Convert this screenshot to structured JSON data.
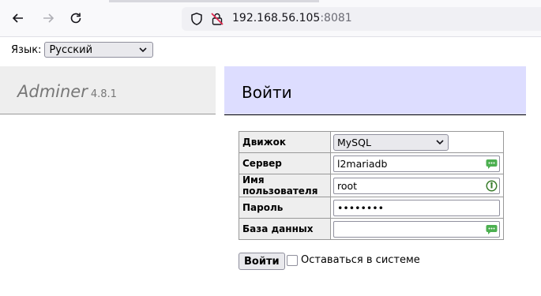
{
  "browser": {
    "url_host": "192.168.56.105",
    "url_port": ":8081"
  },
  "language": {
    "label": "Язык:",
    "selected": "Русский"
  },
  "brand": {
    "name": "Adminer",
    "version": "4.8.1"
  },
  "login": {
    "title": "Войти",
    "fields": {
      "engine": {
        "label": "Движок",
        "value": "MySQL"
      },
      "server": {
        "label": "Сервер",
        "value": "l2mariadb"
      },
      "username": {
        "label": "Имя пользователя",
        "value": "root"
      },
      "password": {
        "label": "Пароль",
        "value": "••••••••"
      },
      "database": {
        "label": "База данных",
        "value": ""
      }
    },
    "submit_label": "Войти",
    "remember_label": "Оставаться в системе"
  },
  "colors": {
    "login_header_bg": "#ddddff",
    "brand_bg": "#eeeeee",
    "field_icon_green": "#4caf50"
  }
}
